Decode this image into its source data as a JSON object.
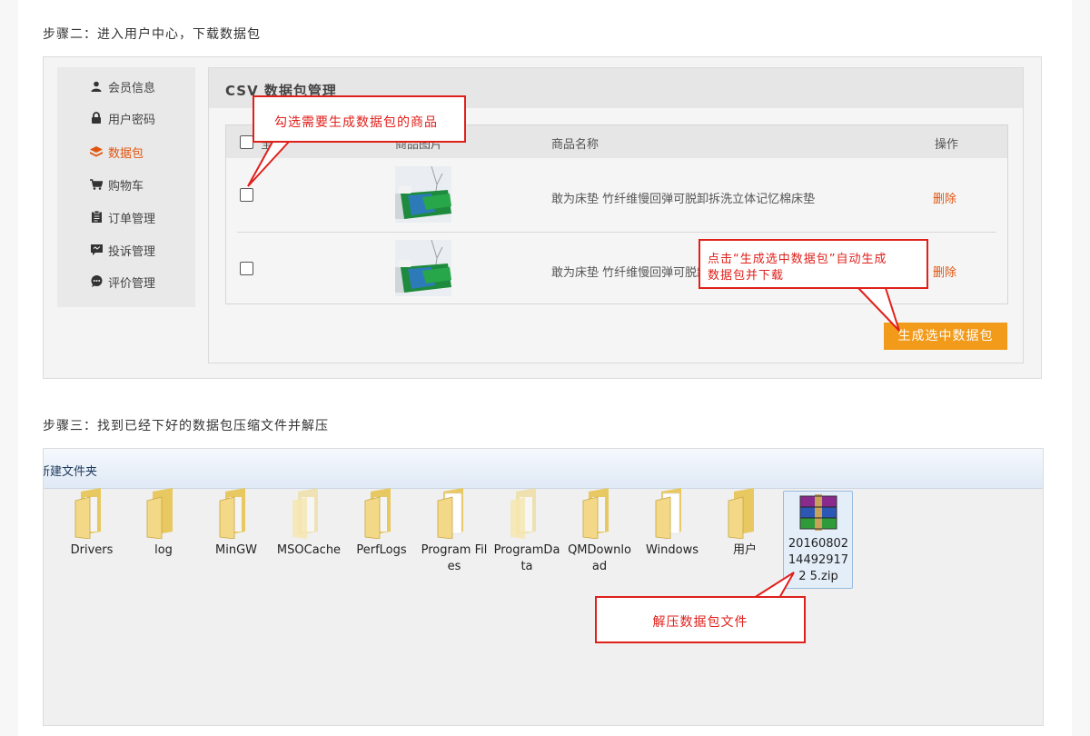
{
  "step2": {
    "title": "步骤二：进入用户中心，下载数据包"
  },
  "step3": {
    "title": "步骤三：找到已经下好的数据包压缩文件并解压"
  },
  "sidebar": {
    "items": [
      {
        "label": "会员信息",
        "icon": "user-icon"
      },
      {
        "label": "用户密码",
        "icon": "lock-icon"
      },
      {
        "label": "数据包",
        "icon": "layers-icon",
        "active": true
      },
      {
        "label": "购物车",
        "icon": "cart-icon"
      },
      {
        "label": "订单管理",
        "icon": "clipboard-icon"
      },
      {
        "label": "投诉管理",
        "icon": "comment-icon"
      },
      {
        "label": "评价管理",
        "icon": "chat-bubble-icon"
      }
    ]
  },
  "csv_panel": {
    "title": "CSV 数据包管理",
    "columns": {
      "select": "全选",
      "image": "商品图片",
      "name": "商品名称",
      "action": "操作"
    },
    "rows": [
      {
        "name": "敢为床垫 竹纤维慢回弹可脱卸拆洗立体记忆棉床垫",
        "action": "删除"
      },
      {
        "name": "敢为床垫 竹纤维慢回弹可脱卸拆洗立体记忆棉床垫",
        "action": "删除"
      }
    ],
    "generate_button": "生成选中数据包"
  },
  "callouts": {
    "select": "勾选需要生成数据包的商品",
    "generate_line1": "点击“生成选中数据包”自动生成",
    "generate_line2": "数据包并下载",
    "unzip": "解压数据包文件"
  },
  "explorer": {
    "new_folder": "新建文件夹",
    "folders": [
      {
        "name": "Drivers"
      },
      {
        "name": "log"
      },
      {
        "name": "MinGW"
      },
      {
        "name": "MSOCache"
      },
      {
        "name": "PerfLogs"
      },
      {
        "name": "Program Files"
      },
      {
        "name": "ProgramData"
      },
      {
        "name": "QMDownload"
      },
      {
        "name": "Windows"
      },
      {
        "name": "用户"
      }
    ],
    "zip_file": "20160802144929172 5.zip",
    "zip_icon": "winrar-archive-icon"
  },
  "colors": {
    "accent": "#e2550f",
    "button": "#f29a1a",
    "callout": "#e0201b"
  }
}
